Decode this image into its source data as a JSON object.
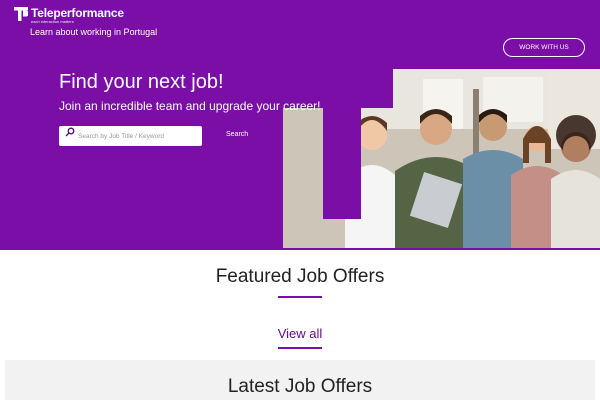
{
  "brand": {
    "name": "Teleperformance",
    "tagline": "each interaction matters"
  },
  "header": {
    "learn_link": "Learn about working in Portugal",
    "work_with_us": "WORK WITH US"
  },
  "hero": {
    "title": "Find your next job!",
    "subtitle": "Join an incredible team and upgrade your career!",
    "search_placeholder": "Search by Job Title / Keyword",
    "search_button": "Search"
  },
  "featured": {
    "title": "Featured Job Offers",
    "view_all": "View all"
  },
  "latest": {
    "title": "Latest Job Offers"
  },
  "colors": {
    "brand_purple": "#7a0ea6",
    "white": "#ffffff"
  },
  "icons": [
    "tp-logo-icon",
    "search-icon"
  ]
}
